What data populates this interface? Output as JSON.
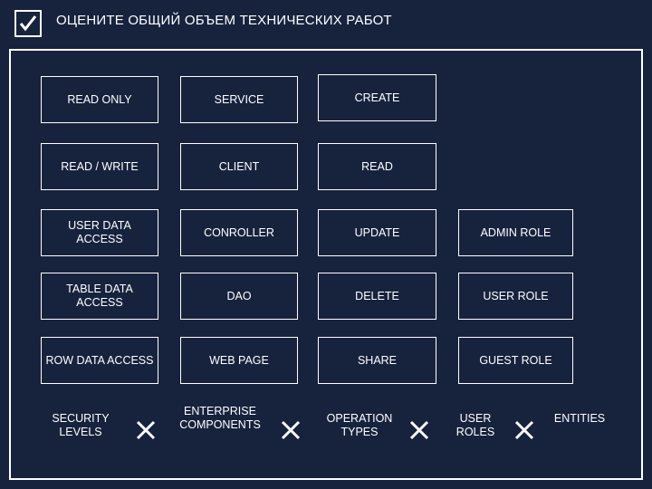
{
  "header": {
    "title": "ОЦЕНИТЕ ОБЩИЙ ОБЪЕМ ТЕХНИЧЕСКИХ РАБОТ",
    "icon": "checkbox-checked-icon"
  },
  "colors": {
    "background": "#17233d",
    "border": "#ffffff",
    "text": "#ffffff"
  },
  "matrix": {
    "columns": [
      {
        "label": "SECURITY LEVELS",
        "cells": [
          "READ ONLY",
          "READ / WRITE",
          "USER DATA ACCESS",
          "TABLE DATA ACCESS",
          "ROW DATA ACCESS"
        ]
      },
      {
        "label": "ENTERPRISE COMPONENTS",
        "cells": [
          "SERVICE",
          "CLIENT",
          "CONROLLER",
          "DAO",
          "WEB PAGE"
        ]
      },
      {
        "label": "OPERATION TYPES",
        "cells": [
          "CREATE",
          "READ",
          "UPDATE",
          "DELETE",
          "SHARE"
        ]
      },
      {
        "label": "USER ROLES",
        "cells": [
          "",
          "",
          "ADMIN ROLE",
          "USER ROLE",
          "GUEST ROLE"
        ]
      }
    ],
    "last_label": "ENTITIES",
    "multiply_symbol": "×"
  }
}
